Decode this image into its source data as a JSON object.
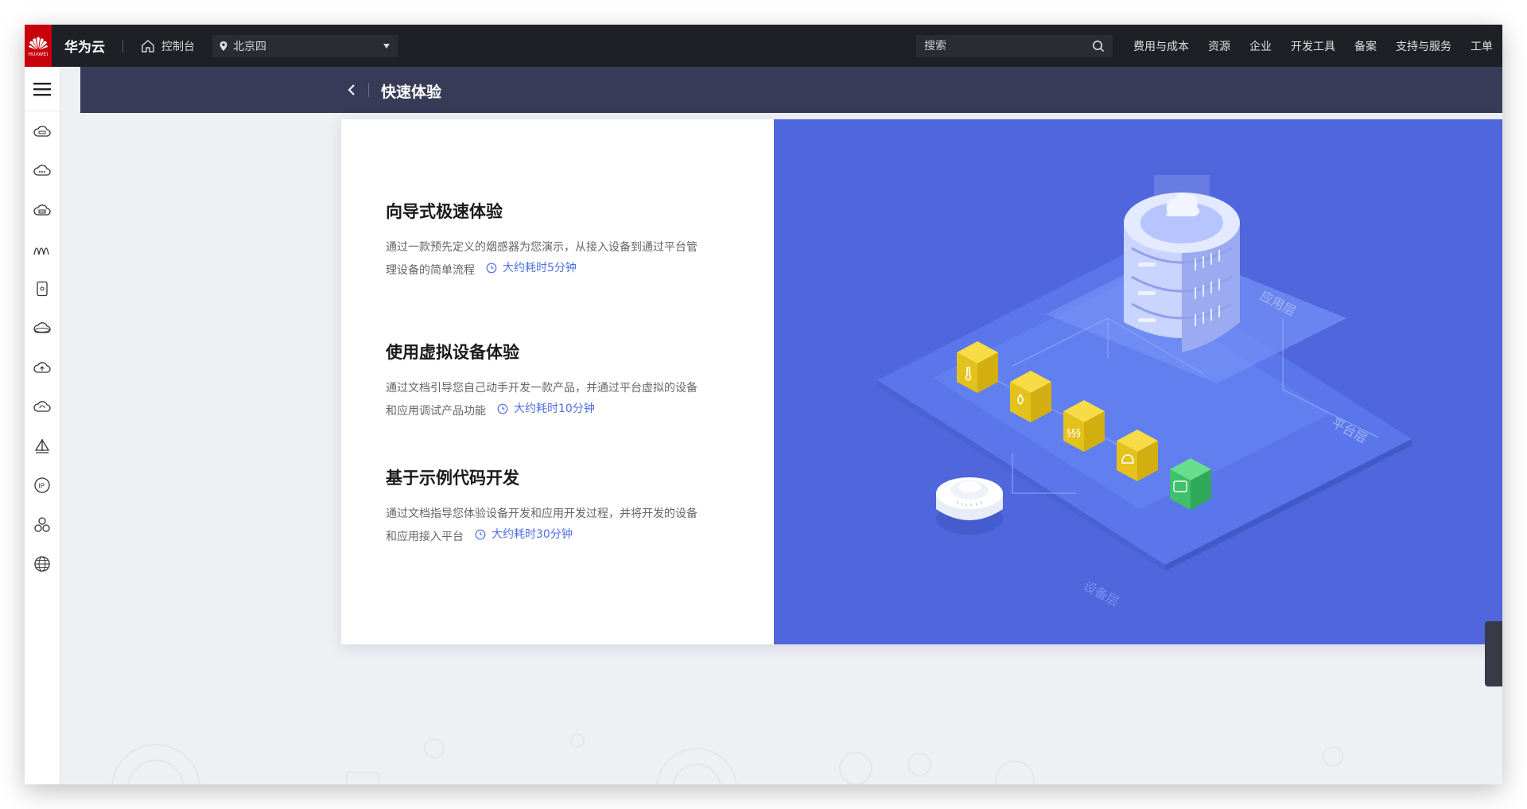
{
  "topbar": {
    "logo_text": "HUAWEI",
    "brand": "华为云",
    "console": "控制台",
    "region": "北京四",
    "search_placeholder": "搜索",
    "nav": [
      "费用与成本",
      "资源",
      "企业",
      "开发工具",
      "备案",
      "支持与服务",
      "工单"
    ]
  },
  "leftrail": {
    "icons": [
      "iot-cloud-icon",
      "cloud-more-icon",
      "cloud-db-icon",
      "waves-icon",
      "device-icon",
      "cloud-ring-icon",
      "cloud-upload-icon",
      "cloud-refresh-icon",
      "sail-icon",
      "ip-icon",
      "cluster-icon",
      "globe-icon"
    ]
  },
  "subheader": {
    "title": "快速体验"
  },
  "items": [
    {
      "title": "向导式极速体验",
      "desc": "通过一款预先定义的烟感器为您演示，从接入设备到通过平台管理设备的简单流程",
      "time": "大约耗时5分钟"
    },
    {
      "title": "使用虚拟设备体验",
      "desc": "通过文档引导您自己动手开发一款产品，并通过平台虚拟的设备和应用调试产品功能",
      "time": "大约耗时10分钟"
    },
    {
      "title": "基于示例代码开发",
      "desc": "通过文档指导您体验设备开发和应用开发过程，并将开发的设备和应用接入平台",
      "time": "大约耗时30分钟"
    }
  ],
  "illustration": {
    "layer_app": "应用层",
    "layer_platform": "平台层",
    "layer_device": "设备层"
  },
  "colors": {
    "topbar": "#1f2026",
    "subheader": "#383b57",
    "illustration_bg": "#4f66dd",
    "accent": "#4e6fe6",
    "cube_yellow": "#f2cf2a",
    "cube_green": "#3fc06b"
  }
}
